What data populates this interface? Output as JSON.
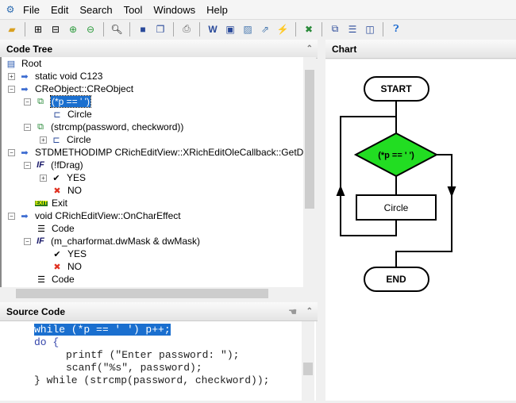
{
  "menu": [
    "File",
    "Edit",
    "Search",
    "Tool",
    "Windows",
    "Help"
  ],
  "toolbar_icons": [
    "open-folder-icon",
    "expand-icon",
    "collapse-icon",
    "zoom-in-icon",
    "zoom-out-icon",
    "find-icon",
    "save-icon",
    "save-all-icon",
    "print-icon",
    "word-export-icon",
    "export-icon",
    "image-icon",
    "export-image-icon",
    "flowchart-icon",
    "tools-icon",
    "cascade-icon",
    "tile-horizontal-icon",
    "tile-vertical-icon",
    "help-icon"
  ],
  "code_tree": {
    "title": "Code Tree",
    "root": "Root",
    "items": [
      "static void C123",
      "CReObject::CReObject",
      "(*p == ' ')",
      "Circle",
      "(strcmp(password, checkword))",
      "Circle",
      "STDMETHODIMP CRichEditView::XRichEditOleCallback::GetDragDrop",
      "(!fDrag)",
      "YES",
      "NO",
      "Exit",
      "void CRichEditView::OnCharEffect",
      "Code",
      "(m_charformat.dwMask & dwMask)",
      "YES",
      "NO",
      "Code"
    ]
  },
  "source": {
    "title": "Source Code",
    "lines": [
      "while (*p == ' ') p++;",
      "do {",
      "printf (\"Enter password: \");",
      "scanf(\"%s\", password);",
      "} while (strcmp(password, checkword));"
    ]
  },
  "chart": {
    "title": "Chart",
    "start": "START",
    "decision": "(*p == ' ')",
    "process": "Circle",
    "end": "END",
    "decision_color": "#22dd22"
  }
}
